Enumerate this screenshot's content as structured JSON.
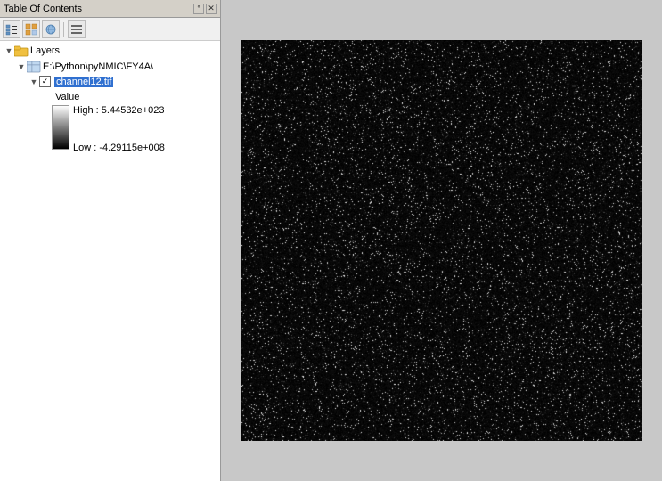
{
  "title_bar": {
    "title": "Table Of Contents",
    "pin_label": "📌",
    "close_label": "✕"
  },
  "toolbar": {
    "buttons": [
      {
        "name": "list-view-btn",
        "label": "≡"
      },
      {
        "name": "source-view-btn",
        "label": "⊞"
      },
      {
        "name": "visibility-btn",
        "label": "👁"
      },
      {
        "name": "options-btn",
        "label": "⊟"
      }
    ]
  },
  "toc": {
    "layers_label": "Layers",
    "folder_label": "E:\\Python\\pyNMIC\\FY4A\\",
    "file_label": "channel12.tif",
    "legend": {
      "value_label": "Value",
      "high_label": "High : 5.44532e+023",
      "low_label": "Low : -4.29115e+008"
    }
  },
  "map": {
    "bg_color": "#c8c8c8"
  }
}
